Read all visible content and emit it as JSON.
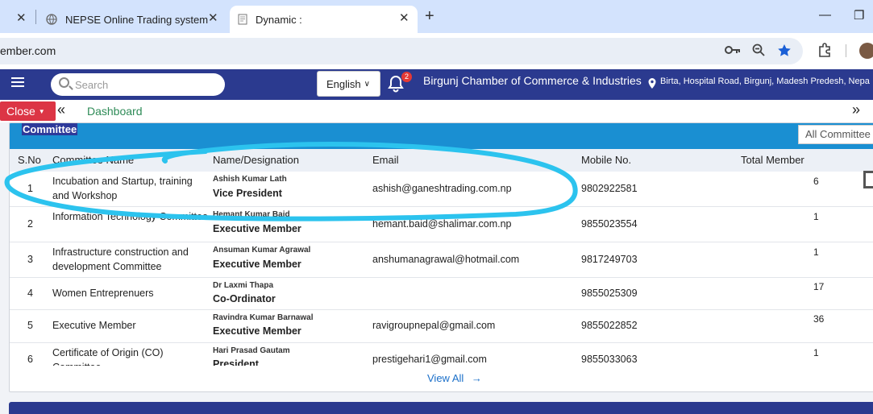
{
  "browser": {
    "tabs": [
      {
        "title": "",
        "active": false
      },
      {
        "title": "NEPSE Online Trading system",
        "active": false
      },
      {
        "title": "Dynamic :",
        "active": true
      }
    ],
    "url": "ember.com"
  },
  "navbar": {
    "search_placeholder": "Search",
    "language": "English",
    "notification_count": "2",
    "org_name": "Birgunj Chamber of Commerce & Industries",
    "location": "Birta, Hospital Road, Birgunj, Madesh Predesh, Nepa"
  },
  "subbar": {
    "close_label": "Close",
    "dashboard_label": "Dashboard"
  },
  "card": {
    "title": "Committee",
    "filter_value": "All Committee",
    "headers": [
      "S.No",
      "Committee Name",
      "Name/Designation",
      "Email",
      "Mobile No.",
      "Total Member"
    ],
    "rows": [
      {
        "sno": "1",
        "committee": "Incubation and Startup, training and Workshop",
        "name": "Ashish Kumar Lath",
        "designation": "Vice President",
        "email": "ashish@ganeshtrading.com.np",
        "mobile": "9802922581",
        "total": "6"
      },
      {
        "sno": "2",
        "committee": "Information Technology Committee",
        "name": "Hemant Kumar Baid",
        "designation": "Executive Member",
        "email": "hemant.baid@shalimar.com.np",
        "mobile": "9855023554",
        "total": "1"
      },
      {
        "sno": "3",
        "committee": "Infrastructure construction and development Committee",
        "name": "Ansuman Kumar Agrawal",
        "designation": "Executive Member",
        "email": "anshumanagrawal@hotmail.com",
        "mobile": "9817249703",
        "total": "1"
      },
      {
        "sno": "4",
        "committee": "Women Entreprenuers",
        "name": "Dr Laxmi Thapa",
        "designation": "Co-Ordinator",
        "email": "",
        "mobile": "9855025309",
        "total": "17"
      },
      {
        "sno": "5",
        "committee": "Executive Member",
        "name": "Ravindra Kumar Barnawal",
        "designation": "Executive Member",
        "email": "ravigroupnepal@gmail.com",
        "mobile": "9855022852",
        "total": "36"
      },
      {
        "sno": "6",
        "committee": "Certificate of Origin (CO) Committee",
        "name": "Hari Prasad Gautam",
        "designation": "President",
        "email": "prestigehari1@gmail.com",
        "mobile": "9855033063",
        "total": "1"
      }
    ],
    "view_all": "View All"
  },
  "colors": {
    "navbar": "#2b3a8f",
    "card_header": "#1a8fd2",
    "close_button": "#dc3545",
    "dashboard_text": "#2e8b57",
    "annotation": "#2cc3ee"
  }
}
